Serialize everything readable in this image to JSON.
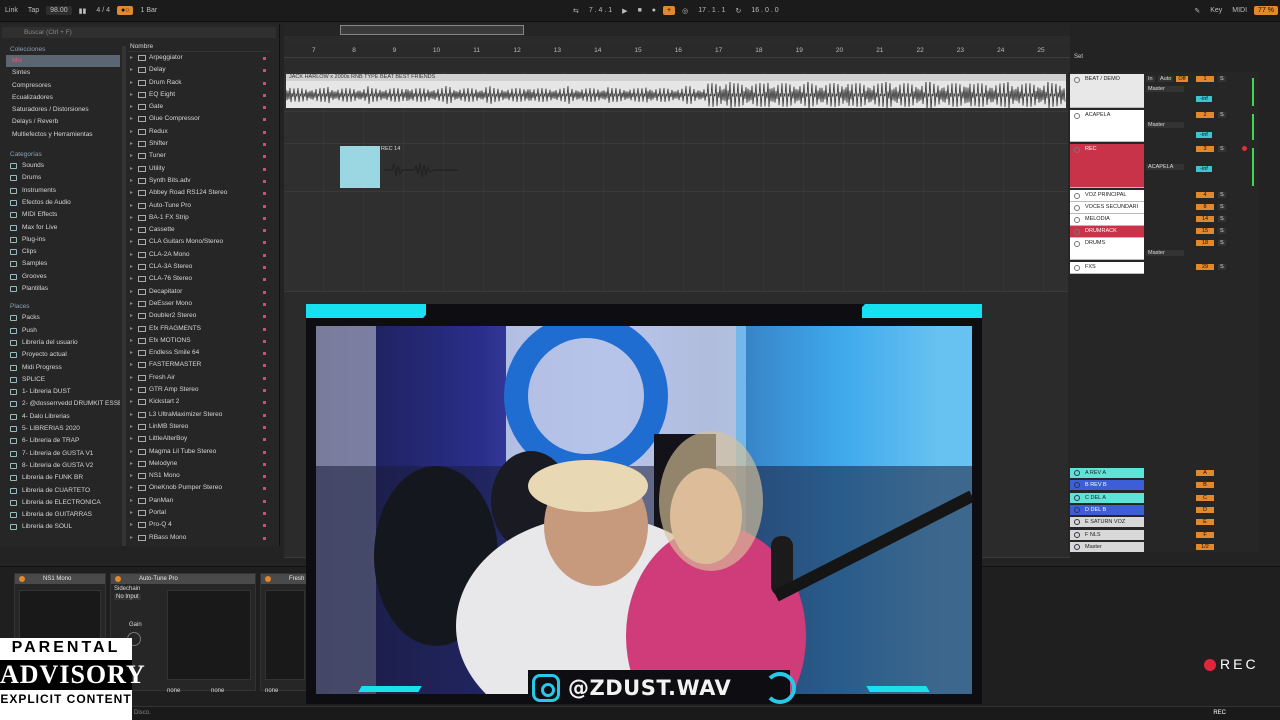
{
  "topbar": {
    "link": "Link",
    "tap": "Tap",
    "tempo": "98.00",
    "sig": "4 / 4",
    "quant": "1 Bar",
    "position": "7 .  4 .  1",
    "loop_start": "17 .  1 .  1",
    "loop_len": "16 .  0 .  0",
    "key": "Key",
    "midi": "MIDI",
    "cpu": "77 %"
  },
  "browser": {
    "search_placeholder": "Buscar (Ctrl + F)",
    "collections_title": "Colecciones",
    "collections": [
      "Mix",
      "Sintes",
      "Compresores",
      "Ecualizadores",
      "Saturadores / Distorsiones",
      "Delays / Reverb",
      "Multiefectos y Herramientas"
    ],
    "categories_title": "Categorías",
    "categories": [
      "Sounds",
      "Drums",
      "Instruments",
      "Efectos de Audio",
      "MIDI Effects",
      "Max for Live",
      "Plug-ins",
      "Clips",
      "Samples",
      "Grooves",
      "Plantillas"
    ],
    "places_title": "Places",
    "places": [
      "Packs",
      "Push",
      "Librería del usuario",
      "Proyecto actual",
      "Midi Progress",
      "SPLICE",
      "1- Libreria DUST",
      "2- @dosserrvedd DRUMKIT ESSE",
      "4- Dalo Librerias",
      "5- LIBRERIAS 2020",
      "6- Libreria de TRAP",
      "7- Libreria de GUSTA V1",
      "8- Libreria de GUSTA V2",
      "Libreria de FUNK BR",
      "Libreria de CUARTETO",
      "Libreria de ELECTRONICA",
      "Libreria de GUITARRAS",
      "Libreria de SOUL"
    ],
    "names_header": "Nombre",
    "names": [
      "Arpeggiator",
      "Delay",
      "Drum Rack",
      "EQ Eight",
      "Gate",
      "Glue Compressor",
      "Redux",
      "Shifter",
      "Tuner",
      "Utility",
      "Synth Bits.adv",
      "Abbey Road RS124 Stereo",
      "Auto-Tune Pro",
      "BA-1 FX Strip",
      "Cassette",
      "CLA Guitars Mono/Stereo",
      "CLA-2A Mono",
      "CLA-3A Stereo",
      "CLA-76 Stereo",
      "Decapitator",
      "DeEsser Mono",
      "Doubler2 Stereo",
      "Efx FRAGMENTS",
      "Efx MOTIONS",
      "Endless Smile 64",
      "FASTERMASTER",
      "Fresh Air",
      "GTR Amp Stereo",
      "Kickstart 2",
      "L3 UltraMaximizer Stereo",
      "LinMB Stereo",
      "LittleAlterBoy",
      "Magma Lil Tube Stereo",
      "Melodyne",
      "NS1 Mono",
      "OneKnob Pumper Stereo",
      "PanMan",
      "Portal",
      "Pro-Q 4",
      "RBass Mono"
    ]
  },
  "arrangement": {
    "ruler": [
      "7",
      "8",
      "9",
      "10",
      "11",
      "12",
      "13",
      "14",
      "15",
      "16",
      "17",
      "18",
      "19",
      "20",
      "21",
      "22",
      "23",
      "24",
      "25"
    ],
    "beat_clip": "JACK HARLOW x 2000s RNB TYPE BEAT BEST FRIENDS",
    "rec_clip": "REC 14",
    "set_label": "Set"
  },
  "tracks": [
    {
      "name": "BEAT / DEMO",
      "color": "#e8e8e8",
      "route": "Master",
      "vol": "1"
    },
    {
      "name": "ACAPELA",
      "color": "#ffffff",
      "route": "Master",
      "vol": "2"
    },
    {
      "name": "REC",
      "color": "#c8334a",
      "route": "ACAPELA",
      "vol": "3"
    },
    {
      "name": "VOZ PRINCIPAL",
      "color": "#ffffff",
      "route": "",
      "vol": "4"
    },
    {
      "name": "VOCES SECUNDARI",
      "color": "#ffffff",
      "route": "",
      "vol": "8"
    },
    {
      "name": "MELODIA",
      "color": "#ffffff",
      "route": "",
      "vol": "14"
    },
    {
      "name": "DRUMRACK",
      "color": "#c8334a",
      "route": "",
      "vol": "15"
    },
    {
      "name": "DRUMS",
      "color": "#ffffff",
      "route": "Master",
      "vol": "18"
    },
    {
      "name": "FXS",
      "color": "#ffffff",
      "route": "",
      "vol": "29"
    }
  ],
  "returns": [
    {
      "name": "A REV A",
      "color": "#5fe2d8",
      "letter": "A"
    },
    {
      "name": "B REV B",
      "color": "#3c5fd8",
      "letter": "B"
    },
    {
      "name": "C DEL A",
      "color": "#5fe2d8",
      "letter": "C"
    },
    {
      "name": "D DEL B",
      "color": "#3c5fd8",
      "letter": "D"
    },
    {
      "name": "E SATURN VOZ",
      "color": "#d8d8d8",
      "letter": "E"
    },
    {
      "name": "F NLS",
      "color": "#d8d8d8",
      "letter": "F"
    },
    {
      "name": "Master",
      "color": "#d8d8d8",
      "letter": "1/2"
    }
  ],
  "track_labels": {
    "in": "In",
    "auto": "Auto",
    "off": "Off",
    "minus_inf": "-inf"
  },
  "devices": [
    {
      "name": "NS1 Mono"
    },
    {
      "name": "Auto-Tune Pro",
      "sidechain": "Sidechain",
      "no_input": "No Input",
      "gain": "Gain"
    },
    {
      "name": "Fresh"
    }
  ],
  "device_selects": [
    "none",
    "none",
    "none"
  ],
  "overlay": {
    "handle": "@ZDUST.WAV",
    "rec": "REC",
    "advisory_1": "PARENTAL",
    "advisory_2": "ADVISORY",
    "advisory_3": "EXPLICIT CONTENT"
  },
  "status": {
    "text": "Disco.",
    "rec": "REC"
  }
}
